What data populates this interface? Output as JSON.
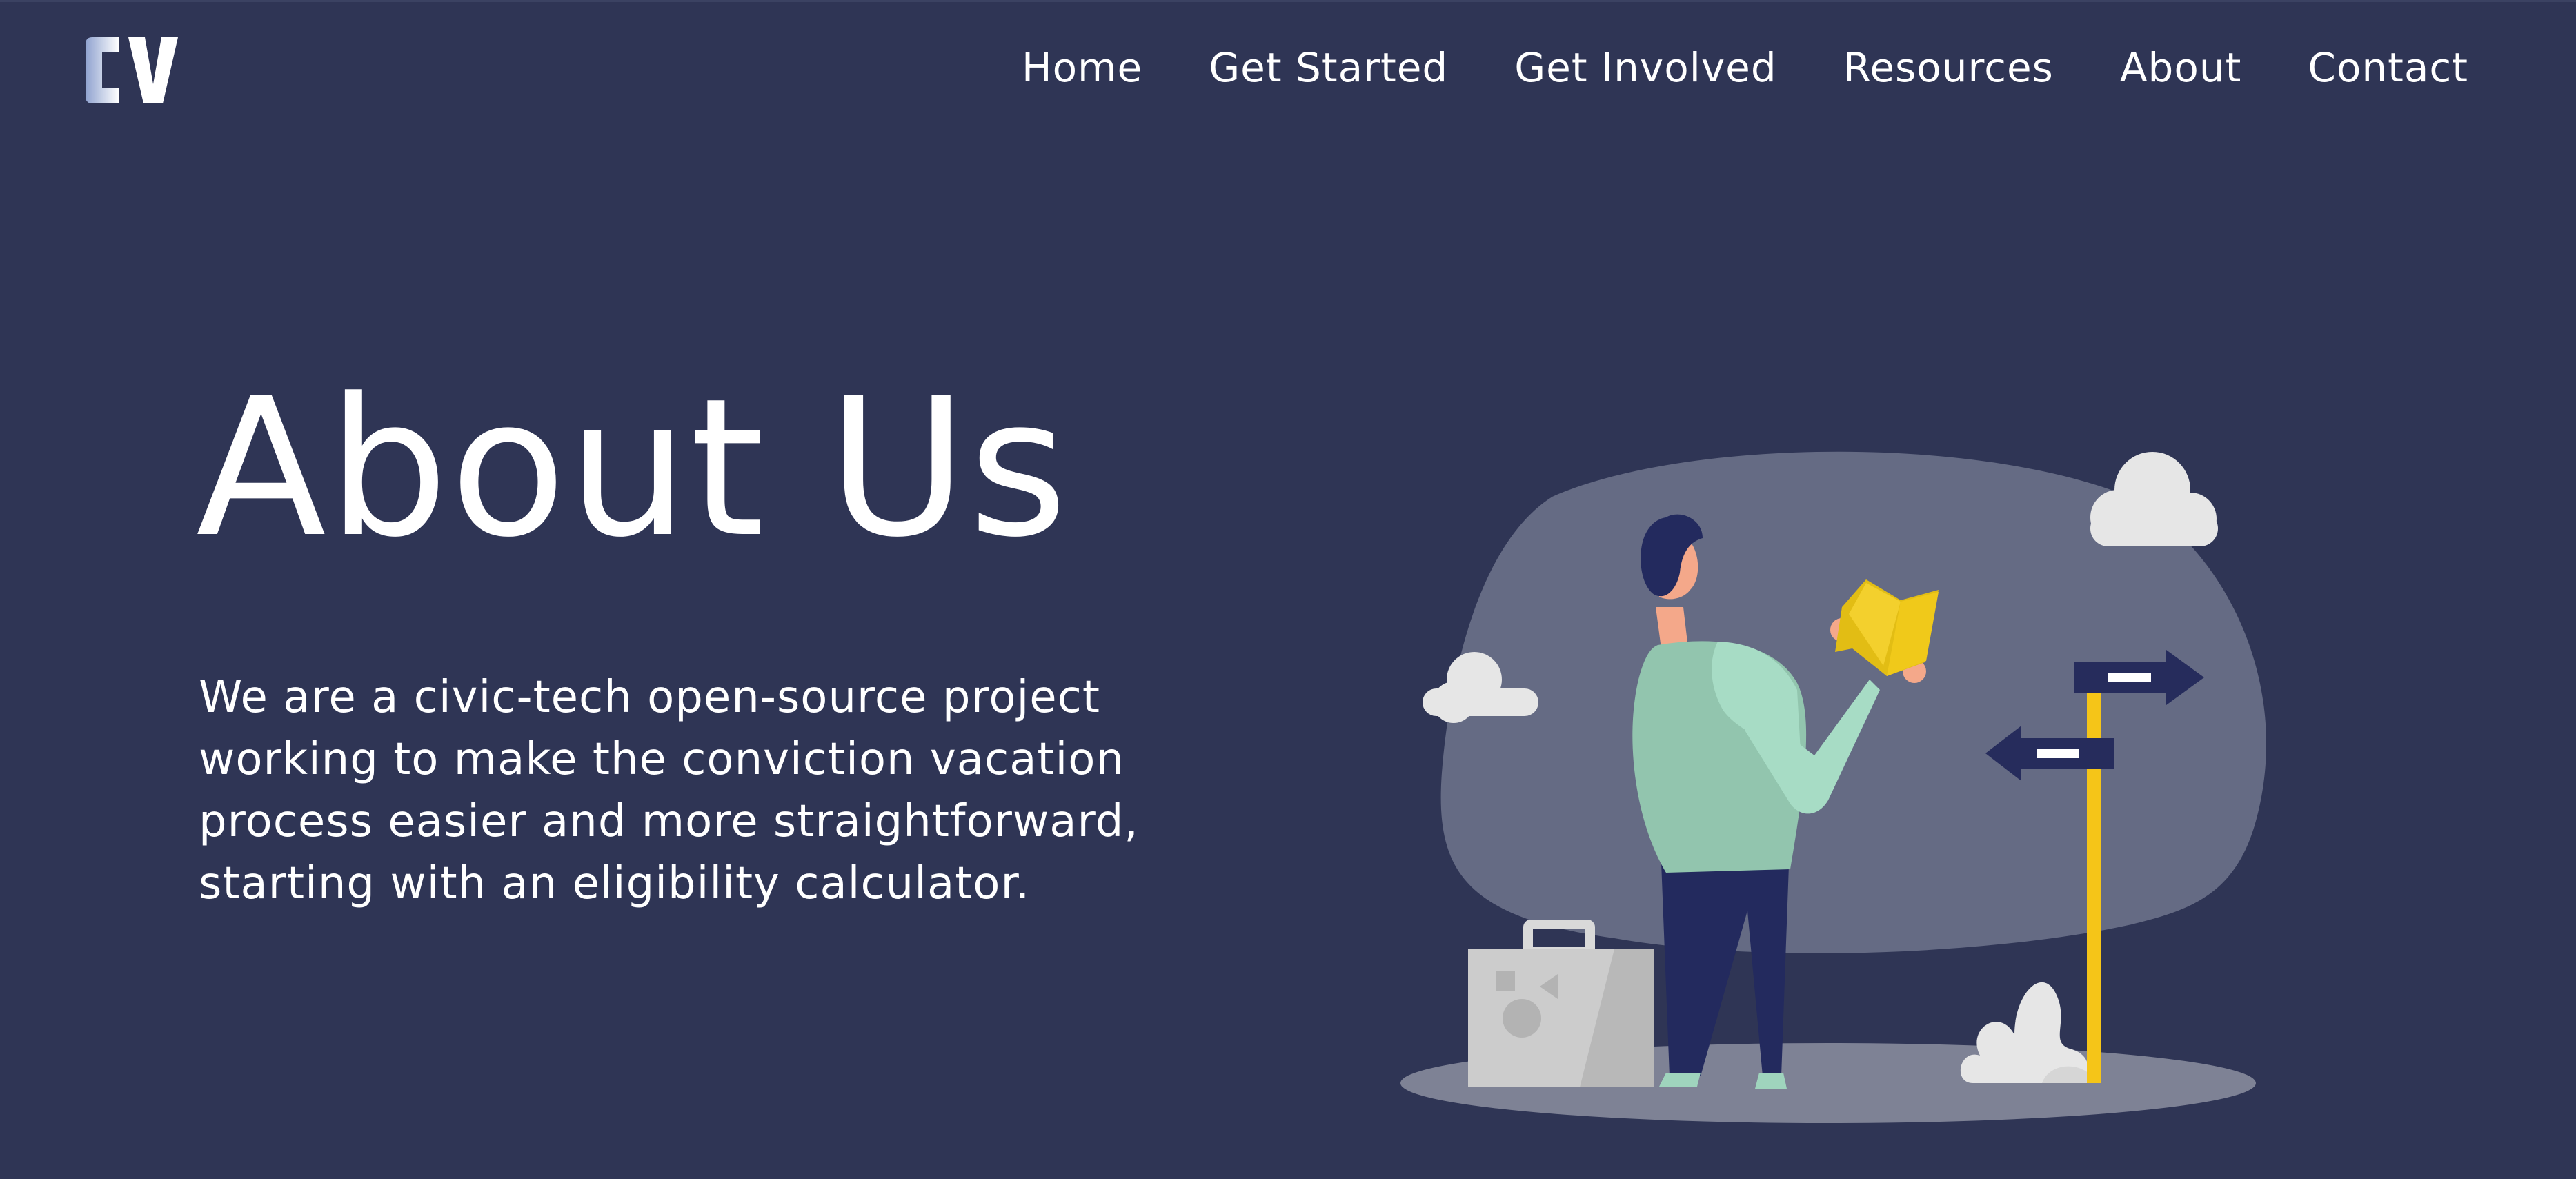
{
  "header": {
    "logo_text": "CV",
    "nav": [
      {
        "label": "Home"
      },
      {
        "label": "Get Started"
      },
      {
        "label": "Get Involved"
      },
      {
        "label": "Resources"
      },
      {
        "label": "About"
      },
      {
        "label": "Contact"
      }
    ]
  },
  "hero": {
    "title": "About Us",
    "description": "We are a civic-tech open-source project working to make the conviction vacation process easier and more straightforward, starting with an eligibility calculator."
  },
  "illustration": {
    "icon": "person-reading-map-illustration",
    "colors": {
      "background": "#2f3555",
      "blob": "#656b84",
      "ground": "#7e8295",
      "map": "#f3d02d",
      "sweater": "#9fd4bd",
      "pants": "#232a5e",
      "signpost": "#f5c518",
      "arrow_sign": "#262c5c",
      "cloud": "#e6e6e6",
      "suitcase": "#cccccc"
    }
  }
}
